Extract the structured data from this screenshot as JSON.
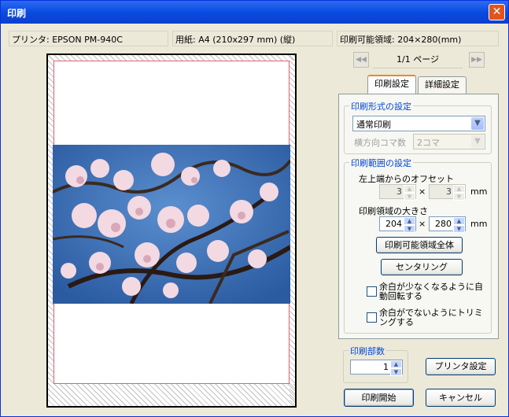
{
  "window": {
    "title": "印刷",
    "close_glyph": "✕"
  },
  "info": {
    "printer": "プリンタ: EPSON PM-940C",
    "paper": "用紙: A4 (210x297 mm) (縦)",
    "printable": "印刷可能領域: 204×280(mm)"
  },
  "nav": {
    "prev_glyph": "◀◀",
    "next_glyph": "▶▶",
    "page_indicator": "1/1 ページ"
  },
  "tabs": [
    {
      "label": "印刷設定",
      "selected": true
    },
    {
      "label": "詳細設定",
      "selected": false
    }
  ],
  "format_group": {
    "title": "印刷形式の設定",
    "mode": "通常印刷",
    "horizontal_label": "横方向コマ数",
    "horizontal_value": "2コマ"
  },
  "range_group": {
    "title": "印刷範囲の設定",
    "offset_label": "左上端からのオフセット",
    "offset_x": "3",
    "offset_y": "3",
    "size_label": "印刷領域の大きさ",
    "size_w": "204",
    "size_h": "280",
    "times": "×",
    "unit": "mm",
    "fill_button": "印刷可能領域全体",
    "center_button": "センタリング",
    "autorotate_label": "余白が少なくなるように自動回転する",
    "trim_label": "余白がでないようにトリミングする"
  },
  "copies_group": {
    "title": "印刷部数",
    "copies": "1"
  },
  "buttons": {
    "printer_settings": "プリンタ設定",
    "start": "印刷開始",
    "cancel": "キャンセル"
  },
  "colors": {
    "title_bar": "#0a4be0",
    "group_title": "#0046d5",
    "print_area_border": "#e06070"
  }
}
